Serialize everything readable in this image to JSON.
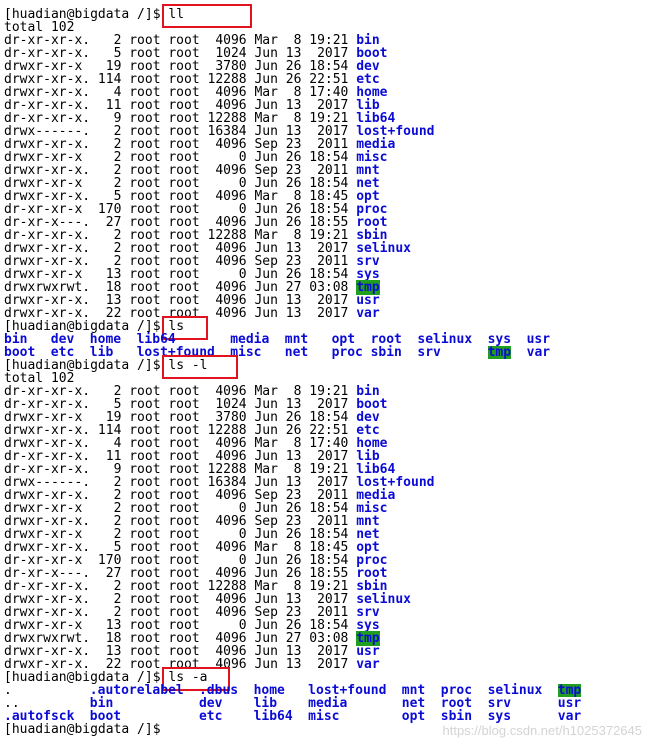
{
  "prompt": "[huadian@bigdata /]$ ",
  "blocks": [
    {
      "command": "ll",
      "total": "total 102",
      "rows": [
        {
          "perm": "dr-xr-xr-x.",
          "links": "2",
          "owner": "root",
          "group": "root",
          "size": "4096",
          "month": "Mar",
          "day": "8",
          "time": "19:21",
          "name": "bin"
        },
        {
          "perm": "dr-xr-xr-x.",
          "links": "5",
          "owner": "root",
          "group": "root",
          "size": "1024",
          "month": "Jun",
          "day": "13",
          "time": "2017",
          "name": "boot"
        },
        {
          "perm": "drwxr-xr-x",
          "links": "19",
          "owner": "root",
          "group": "root",
          "size": "3780",
          "month": "Jun",
          "day": "26",
          "time": "18:54",
          "name": "dev"
        },
        {
          "perm": "drwxr-xr-x.",
          "links": "114",
          "owner": "root",
          "group": "root",
          "size": "12288",
          "month": "Jun",
          "day": "26",
          "time": "22:51",
          "name": "etc"
        },
        {
          "perm": "drwxr-xr-x.",
          "links": "4",
          "owner": "root",
          "group": "root",
          "size": "4096",
          "month": "Mar",
          "day": "8",
          "time": "17:40",
          "name": "home"
        },
        {
          "perm": "dr-xr-xr-x.",
          "links": "11",
          "owner": "root",
          "group": "root",
          "size": "4096",
          "month": "Jun",
          "day": "13",
          "time": "2017",
          "name": "lib"
        },
        {
          "perm": "dr-xr-xr-x.",
          "links": "9",
          "owner": "root",
          "group": "root",
          "size": "12288",
          "month": "Mar",
          "day": "8",
          "time": "19:21",
          "name": "lib64"
        },
        {
          "perm": "drwx------.",
          "links": "2",
          "owner": "root",
          "group": "root",
          "size": "16384",
          "month": "Jun",
          "day": "13",
          "time": "2017",
          "name": "lost+found"
        },
        {
          "perm": "drwxr-xr-x.",
          "links": "2",
          "owner": "root",
          "group": "root",
          "size": "4096",
          "month": "Sep",
          "day": "23",
          "time": "2011",
          "name": "media"
        },
        {
          "perm": "drwxr-xr-x",
          "links": "2",
          "owner": "root",
          "group": "root",
          "size": "0",
          "month": "Jun",
          "day": "26",
          "time": "18:54",
          "name": "misc"
        },
        {
          "perm": "drwxr-xr-x.",
          "links": "2",
          "owner": "root",
          "group": "root",
          "size": "4096",
          "month": "Sep",
          "day": "23",
          "time": "2011",
          "name": "mnt"
        },
        {
          "perm": "drwxr-xr-x",
          "links": "2",
          "owner": "root",
          "group": "root",
          "size": "0",
          "month": "Jun",
          "day": "26",
          "time": "18:54",
          "name": "net"
        },
        {
          "perm": "drwxr-xr-x.",
          "links": "5",
          "owner": "root",
          "group": "root",
          "size": "4096",
          "month": "Mar",
          "day": "8",
          "time": "18:45",
          "name": "opt"
        },
        {
          "perm": "dr-xr-xr-x",
          "links": "170",
          "owner": "root",
          "group": "root",
          "size": "0",
          "month": "Jun",
          "day": "26",
          "time": "18:54",
          "name": "proc"
        },
        {
          "perm": "dr-xr-x---.",
          "links": "27",
          "owner": "root",
          "group": "root",
          "size": "4096",
          "month": "Jun",
          "day": "26",
          "time": "18:55",
          "name": "root"
        },
        {
          "perm": "dr-xr-xr-x.",
          "links": "2",
          "owner": "root",
          "group": "root",
          "size": "12288",
          "month": "Mar",
          "day": "8",
          "time": "19:21",
          "name": "sbin"
        },
        {
          "perm": "drwxr-xr-x.",
          "links": "2",
          "owner": "root",
          "group": "root",
          "size": "4096",
          "month": "Jun",
          "day": "13",
          "time": "2017",
          "name": "selinux"
        },
        {
          "perm": "drwxr-xr-x.",
          "links": "2",
          "owner": "root",
          "group": "root",
          "size": "4096",
          "month": "Sep",
          "day": "23",
          "time": "2011",
          "name": "srv"
        },
        {
          "perm": "drwxr-xr-x",
          "links": "13",
          "owner": "root",
          "group": "root",
          "size": "0",
          "month": "Jun",
          "day": "26",
          "time": "18:54",
          "name": "sys"
        },
        {
          "perm": "drwxrwxrwt.",
          "links": "18",
          "owner": "root",
          "group": "root",
          "size": "4096",
          "month": "Jun",
          "day": "27",
          "time": "03:08",
          "name": "tmp",
          "hl": true
        },
        {
          "perm": "drwxr-xr-x.",
          "links": "13",
          "owner": "root",
          "group": "root",
          "size": "4096",
          "month": "Jun",
          "day": "13",
          "time": "2017",
          "name": "usr"
        },
        {
          "perm": "drwxr-xr-x.",
          "links": "22",
          "owner": "root",
          "group": "root",
          "size": "4096",
          "month": "Jun",
          "day": "13",
          "time": "2017",
          "name": "var"
        }
      ]
    },
    {
      "command": "ls",
      "grid": [
        [
          "bin",
          "dev",
          "home",
          "lib64",
          "media",
          "mnt",
          "opt",
          "root",
          "selinux",
          "sys",
          "usr"
        ],
        [
          "boot",
          "etc",
          "lib",
          "lost+found",
          "misc",
          "net",
          "proc",
          "sbin",
          "srv",
          "tmp",
          "var"
        ]
      ]
    },
    {
      "command": "ls -l",
      "total": "total 102",
      "rows_ref": "same as ll"
    },
    {
      "command": "ls -a",
      "grid": [
        [
          ".",
          ".autorelabel",
          ".dbus",
          "home",
          "lost+found",
          "mnt",
          "proc",
          "selinux",
          "tmp"
        ],
        [
          "..",
          "bin",
          "dev",
          "lib",
          "media",
          "net",
          "root",
          "srv",
          "usr"
        ],
        [
          ".autofsck",
          "boot",
          "etc",
          "lib64",
          "misc",
          "opt",
          "sbin",
          "sys",
          "var"
        ]
      ]
    }
  ],
  "final_prompt": "[huadian@bigdata /]$ ",
  "watermark": "https://blog.csdn.net/h1025372645",
  "colors": {
    "dir": "#0b0bd6",
    "tmp_bg": "#1f9e1f",
    "highlight_box": "#e0131f"
  }
}
